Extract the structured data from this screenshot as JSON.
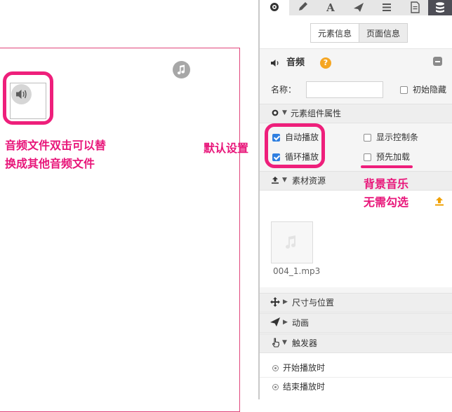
{
  "canvas": {
    "annotation_audio_line1": "音频文件双击可以替",
    "annotation_audio_line2": "换成其他音频文件",
    "annotation_default": "默认设置"
  },
  "panel": {
    "toolbar": {
      "icons": [
        "gear-icon",
        "pencil-icon",
        "text-icon",
        "send-icon",
        "list-icon",
        "document-icon",
        "layers-icon"
      ],
      "active": "gear-icon"
    },
    "tabs": {
      "element_info": "元素信息",
      "page_info": "页面信息",
      "active": "element_info"
    },
    "audio_section": {
      "title": "音频",
      "help": "?"
    },
    "name_label": "名称：",
    "name_value": "",
    "hide_initially_label": "初始隐藏",
    "component_props": {
      "title": "元素组件属性",
      "autoplay_label": "自动播放",
      "autoplay_checked": true,
      "loop_label": "循环播放",
      "loop_checked": true,
      "show_controls_label": "显示控制条",
      "show_controls_checked": false,
      "preload_label": "预先加载",
      "preload_checked": false
    },
    "assets": {
      "title": "素材资源",
      "file_name": "004_1.mp3"
    },
    "annotation_bg_line1": "背景音乐",
    "annotation_bg_line2": "无需勾选",
    "size_position_title": "尺寸与位置",
    "animation_title": "动画",
    "trigger": {
      "title": "触发器",
      "start_label": "开始播放时",
      "end_label": "结束播放时"
    },
    "colors": {
      "annotation": "#e8167a",
      "checkbox_on": "#2f7fe0",
      "help": "#f5a623",
      "upload": "#f0a000"
    }
  }
}
